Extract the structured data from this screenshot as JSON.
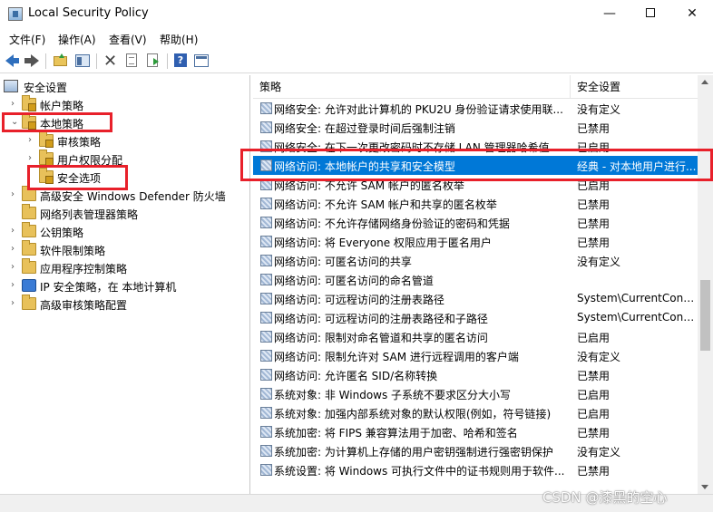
{
  "window": {
    "title": "Local Security Policy",
    "minimize": "—",
    "close": "✕"
  },
  "menu": [
    "文件(F)",
    "操作(A)",
    "查看(V)",
    "帮助(H)"
  ],
  "toolbar": {
    "buttons": [
      "back-icon",
      "forward-icon",
      "up-folder-icon",
      "show-hide-tree-icon",
      "delete-icon",
      "properties-icon",
      "export-list-icon",
      "help-icon",
      "show-pane-icon"
    ]
  },
  "tree": {
    "root": "安全设置",
    "items": [
      {
        "label": "帐户策略",
        "expanded": false
      },
      {
        "label": "本地策略",
        "expanded": true
      },
      {
        "label": "审核策略"
      },
      {
        "label": "用户权限分配"
      },
      {
        "label": "安全选项",
        "selected": true
      },
      {
        "label": "高级安全 Windows Defender 防火墙"
      },
      {
        "label": "网络列表管理器策略"
      },
      {
        "label": "公钥策略"
      },
      {
        "label": "软件限制策略"
      },
      {
        "label": "应用程序控制策略"
      },
      {
        "label": "IP 安全策略，在 本地计算机"
      },
      {
        "label": "高级审核策略配置"
      }
    ]
  },
  "list": {
    "columns": [
      "策略",
      "安全设置"
    ],
    "rows": [
      {
        "policy": "网络安全: 允许对此计算机的 PKU2U 身份验证请求使用联...",
        "setting": "没有定义"
      },
      {
        "policy": "网络安全: 在超过登录时间后强制注销",
        "setting": "已禁用"
      },
      {
        "policy": "网络安全: 在下一次更改密码时不存储 LAN 管理器哈希值",
        "setting": "已启用"
      },
      {
        "policy": "网络访问: 本地帐户的共享和安全模型",
        "setting": "经典 - 对本地用户进行...",
        "selected": true
      },
      {
        "policy": "网络访问: 不允许 SAM 帐户的匿名枚举",
        "setting": "已启用"
      },
      {
        "policy": "网络访问: 不允许 SAM 帐户和共享的匿名枚举",
        "setting": "已禁用"
      },
      {
        "policy": "网络访问: 不允许存储网络身份验证的密码和凭据",
        "setting": "已禁用"
      },
      {
        "policy": "网络访问: 将 Everyone 权限应用于匿名用户",
        "setting": "已禁用"
      },
      {
        "policy": "网络访问: 可匿名访问的共享",
        "setting": "没有定义"
      },
      {
        "policy": "网络访问: 可匿名访问的命名管道",
        "setting": ""
      },
      {
        "policy": "网络访问: 可远程访问的注册表路径",
        "setting": "System\\CurrentControl"
      },
      {
        "policy": "网络访问: 可远程访问的注册表路径和子路径",
        "setting": "System\\CurrentControl"
      },
      {
        "policy": "网络访问: 限制对命名管道和共享的匿名访问",
        "setting": "已启用"
      },
      {
        "policy": "网络访问: 限制允许对 SAM 进行远程调用的客户端",
        "setting": "没有定义"
      },
      {
        "policy": "网络访问: 允许匿名 SID/名称转换",
        "setting": "已禁用"
      },
      {
        "policy": "系统对象: 非 Windows 子系统不要求区分大小写",
        "setting": "已启用"
      },
      {
        "policy": "系统对象: 加强内部系统对象的默认权限(例如，符号链接)",
        "setting": "已启用"
      },
      {
        "policy": "系统加密: 将 FIPS 兼容算法用于加密、哈希和签名",
        "setting": "已禁用"
      },
      {
        "policy": "系统加密: 为计算机上存储的用户密钥强制进行强密钥保护",
        "setting": "没有定义"
      },
      {
        "policy": "系统设置: 将 Windows 可执行文件中的证书规则用于软件...",
        "setting": "已禁用"
      }
    ]
  },
  "watermark": "CSDN @漆黑的空心",
  "colors": {
    "selection": "#0078d7",
    "highlight_box": "#e8202a"
  }
}
